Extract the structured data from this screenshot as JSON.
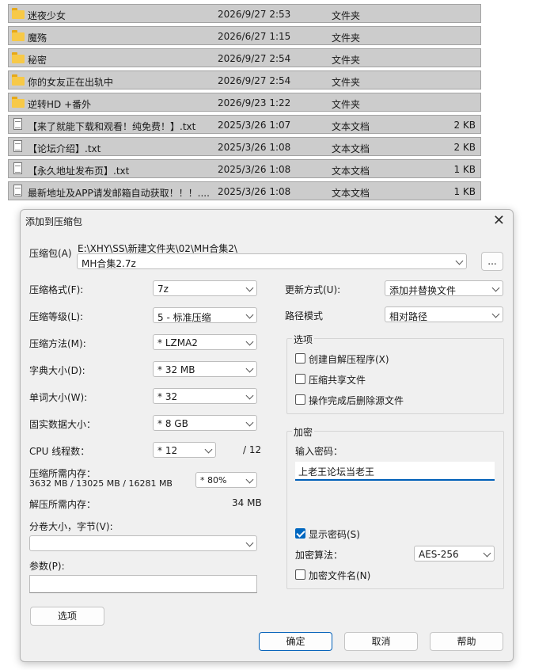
{
  "file_list": [
    {
      "icon": "folder-icon",
      "name": "迷夜少女",
      "date": "2026/9/27 2:53",
      "type": "文件夹",
      "size": ""
    },
    {
      "icon": "folder-icon",
      "name": "魔殇",
      "date": "2026/6/27 1:15",
      "type": "文件夹",
      "size": ""
    },
    {
      "icon": "folder-icon",
      "name": "秘密",
      "date": "2026/9/27 2:54",
      "type": "文件夹",
      "size": ""
    },
    {
      "icon": "folder-icon",
      "name": "你的女友正在出轨中",
      "date": "2026/9/27 2:54",
      "type": "文件夹",
      "size": ""
    },
    {
      "icon": "folder-icon",
      "name": "逆转HD +番外",
      "date": "2026/9/23 1:22",
      "type": "文件夹",
      "size": ""
    },
    {
      "icon": "doc-icon",
      "name": "【来了就能下载和观看！纯免费！】.txt",
      "date": "2025/3/26 1:07",
      "type": "文本文档",
      "size": "2 KB"
    },
    {
      "icon": "doc-icon",
      "name": "【论坛介绍】.txt",
      "date": "2025/3/26 1:08",
      "type": "文本文档",
      "size": "2 KB"
    },
    {
      "icon": "doc-icon",
      "name": "【永久地址发布页】.txt",
      "date": "2025/3/26 1:08",
      "type": "文本文档",
      "size": "1 KB"
    },
    {
      "icon": "doc-icon",
      "name": "最新地址及APP请发邮箱自动获取！！！....",
      "date": "2025/3/26 1:08",
      "type": "文本文档",
      "size": "1 KB"
    }
  ],
  "dialog": {
    "title": "添加到压缩包",
    "close_glyph": "✕",
    "archive_label": "压缩包(A)",
    "archive_path": "E:\\XHY\\SS\\新建文件夹\\02\\MH合集2\\",
    "archive_name": "MH合集2.7z",
    "browse_label": "...",
    "left_fields": [
      {
        "label": "压缩格式(F):",
        "value": "7z"
      },
      {
        "label": "压缩等级(L):",
        "value": "5 - 标准压缩"
      },
      {
        "label": "压缩方法(M):",
        "value": "*  LZMA2"
      },
      {
        "label": "字典大小(D):",
        "value": "*  32 MB"
      },
      {
        "label": "单词大小(W):",
        "value": "*  32"
      },
      {
        "label": "固实数据大小：",
        "value": "*  8 GB"
      }
    ],
    "cpu_label": "CPU 线程数：",
    "cpu_value": "*  12",
    "cpu_max": "/ 12",
    "mem_compress_label": "压缩所需内存：",
    "mem_compress_detail": "3632 MB / 13025 MB / 16281 MB",
    "mem_percent": "*  80%",
    "mem_decompress_label": "解压所需内存：",
    "mem_decompress_value": "34 MB",
    "split_label": "分卷大小，字节(V):",
    "params_label": "参数(P):",
    "options_button": "选项",
    "update_label": "更新方式(U):",
    "update_value": "添加并替换文件",
    "path_mode_label": "路径模式",
    "path_mode_value": "相对路径",
    "options_group": {
      "title": "选项",
      "items": [
        {
          "label": "创建自解压程序(X)",
          "checked": false
        },
        {
          "label": "压缩共享文件",
          "checked": false
        },
        {
          "label": "操作完成后删除源文件",
          "checked": false
        }
      ]
    },
    "encryption": {
      "title": "加密",
      "password_label": "输入密码：",
      "password_value": "上老王论坛当老王",
      "show_password_label": "显示密码(S)",
      "show_password_checked": true,
      "method_label": "加密算法：",
      "method_value": "AES-256",
      "encrypt_names_label": "加密文件名(N)",
      "encrypt_names_checked": false
    },
    "ok_button": "确定",
    "cancel_button": "取消",
    "help_button": "帮助"
  }
}
